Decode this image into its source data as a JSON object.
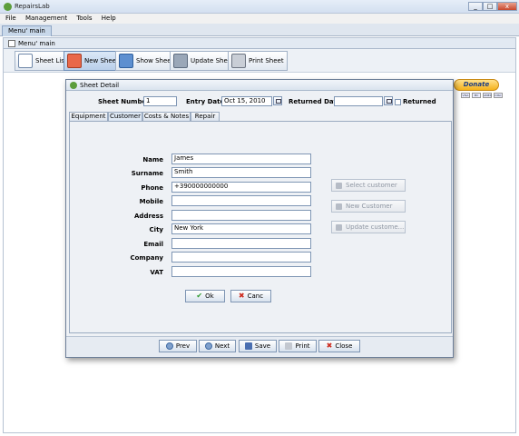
{
  "window": {
    "title": "RepairsLab"
  },
  "menubar": {
    "items": [
      "File",
      "Management",
      "Tools",
      "Help"
    ]
  },
  "main_tab": {
    "label": "Menu' main"
  },
  "subwindow": {
    "title": "Menu' main"
  },
  "toolbar": {
    "buttons": [
      {
        "label": "Sheet List",
        "icon": "list-icon"
      },
      {
        "label": "New Sheet",
        "icon": "new-sheet-icon"
      },
      {
        "label": "Show Sheet",
        "icon": "show-sheet-icon"
      },
      {
        "label": "Update Sheet",
        "icon": "update-sheet-icon"
      },
      {
        "label": "Print Sheet",
        "icon": "printer-icon"
      }
    ]
  },
  "donate": {
    "label": "Donate",
    "cards": [
      "VISA",
      "MC",
      "AMEX",
      "DISC"
    ]
  },
  "dialog": {
    "title": "Sheet Detail",
    "sheet_number_label": "Sheet Number:",
    "sheet_number_value": "1",
    "entry_date_label": "Entry Date:",
    "entry_date_value": "Oct 15, 2010",
    "returned_date_label": "Returned Data:",
    "returned_date_value": "",
    "returned_label": "Returned",
    "tabs": [
      "Equipment",
      "Customer",
      "Costs & Notes",
      "Repair"
    ],
    "active_tab": "Customer",
    "form": {
      "name_label": "Name",
      "name_value": "James",
      "surname_label": "Surname",
      "surname_value": "Smith",
      "phone_label": "Phone",
      "phone_value": "+390000000000",
      "mobile_label": "Mobile",
      "mobile_value": "",
      "address_label": "Address",
      "address_value": "",
      "city_label": "City",
      "city_value": "New York",
      "email_label": "Email",
      "email_value": "",
      "company_label": "Company",
      "company_value": "",
      "vat_label": "VAT",
      "vat_value": ""
    },
    "side_buttons": {
      "select_customer": "Select customer",
      "new_customer": "New Customer",
      "update_customer": "Update custome..."
    },
    "ok_label": "Ok",
    "cancel_label": "Canc",
    "nav": {
      "prev": "Prev",
      "next": "Next",
      "save": "Save",
      "print": "Print",
      "close": "Close"
    },
    "colors": {
      "ok_check": "#2e9b2e",
      "cancel_x": "#cc2a1d",
      "close_x": "#cc2a1d"
    }
  }
}
